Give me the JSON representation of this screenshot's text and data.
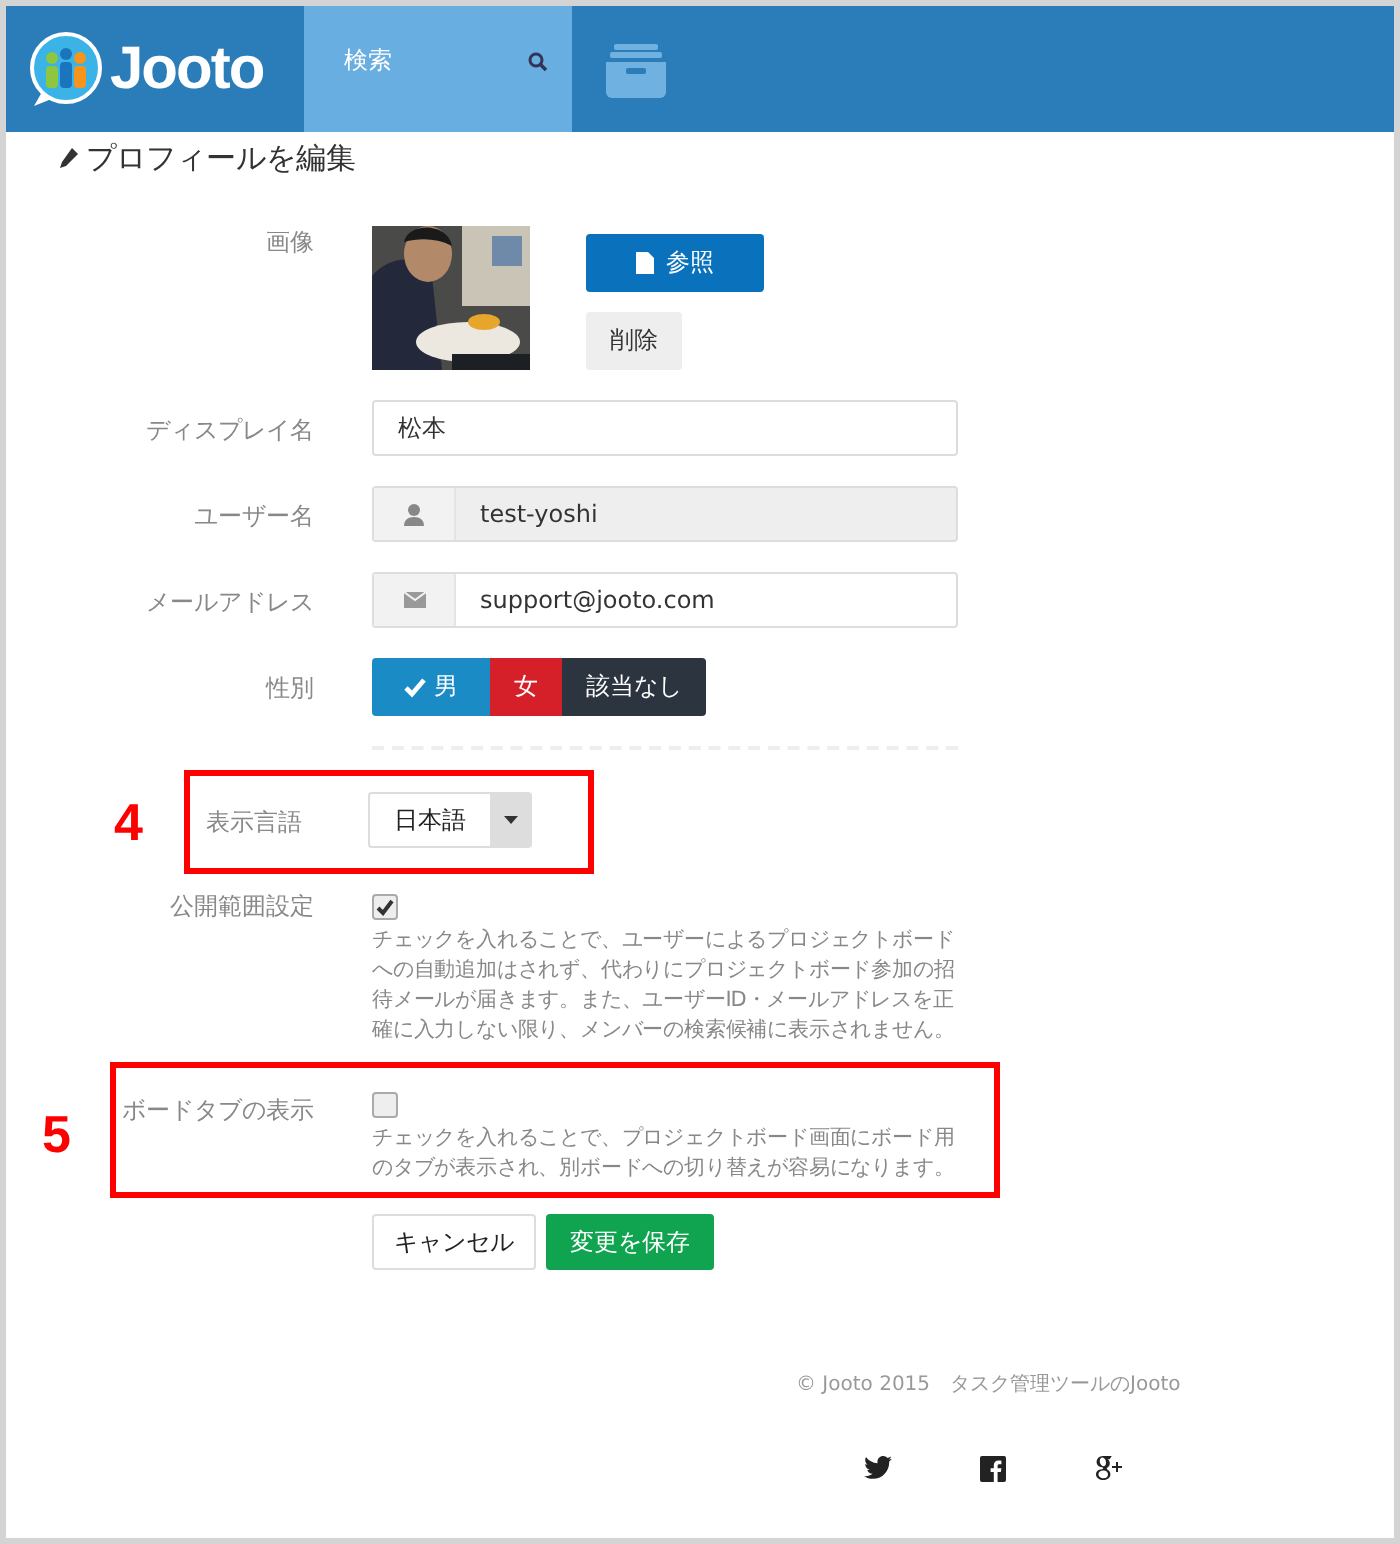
{
  "header": {
    "logo": "Jooto",
    "search": {
      "label": "検索"
    }
  },
  "page_title": "プロフィールを編集",
  "image_row": {
    "label": "画像",
    "browse_button": "参照",
    "delete_button": "削除"
  },
  "display_name": {
    "label": "ディスプレイ名",
    "value": "松本"
  },
  "username": {
    "label": "ユーザー名",
    "value": "test-yoshi",
    "disabled": true
  },
  "email": {
    "label": "メールアドレス",
    "value": "support@jooto.com",
    "disabled": false
  },
  "gender": {
    "label": "性別",
    "options": [
      {
        "label": "男",
        "selected": true,
        "color": "#1a8bc4"
      },
      {
        "label": "女",
        "selected": false,
        "color": "#d62029"
      },
      {
        "label": "該当なし",
        "selected": false,
        "color": "#2c3440"
      }
    ]
  },
  "language": {
    "label": "表示言語",
    "value": "日本語",
    "callout": "4"
  },
  "visibility": {
    "label": "公開範囲設定",
    "checked": true,
    "help": "チェックを入れることで、ユーザーによるプロジェクトボードへの自動追加はされず、代わりにプロジェクトボード参加の招待メールが届きます。また、ユーザーID・メールアドレスを正確に入力しない限り、メンバーの検索候補に表示されません。"
  },
  "board_tabs": {
    "label": "ボードタブの表示",
    "checked": false,
    "help": "チェックを入れることで、プロジェクトボード画面にボード用のタブが表示され、別ボードへの切り替えが容易になります。",
    "callout": "5"
  },
  "buttons": {
    "cancel": "キャンセル",
    "save": "変更を保存"
  },
  "footer": {
    "copyright": "© Jooto 2015　タスク管理ツールのJooto",
    "social": [
      {
        "kind": "twitter"
      },
      {
        "kind": "facebook"
      },
      {
        "kind": "googleplus"
      }
    ]
  }
}
